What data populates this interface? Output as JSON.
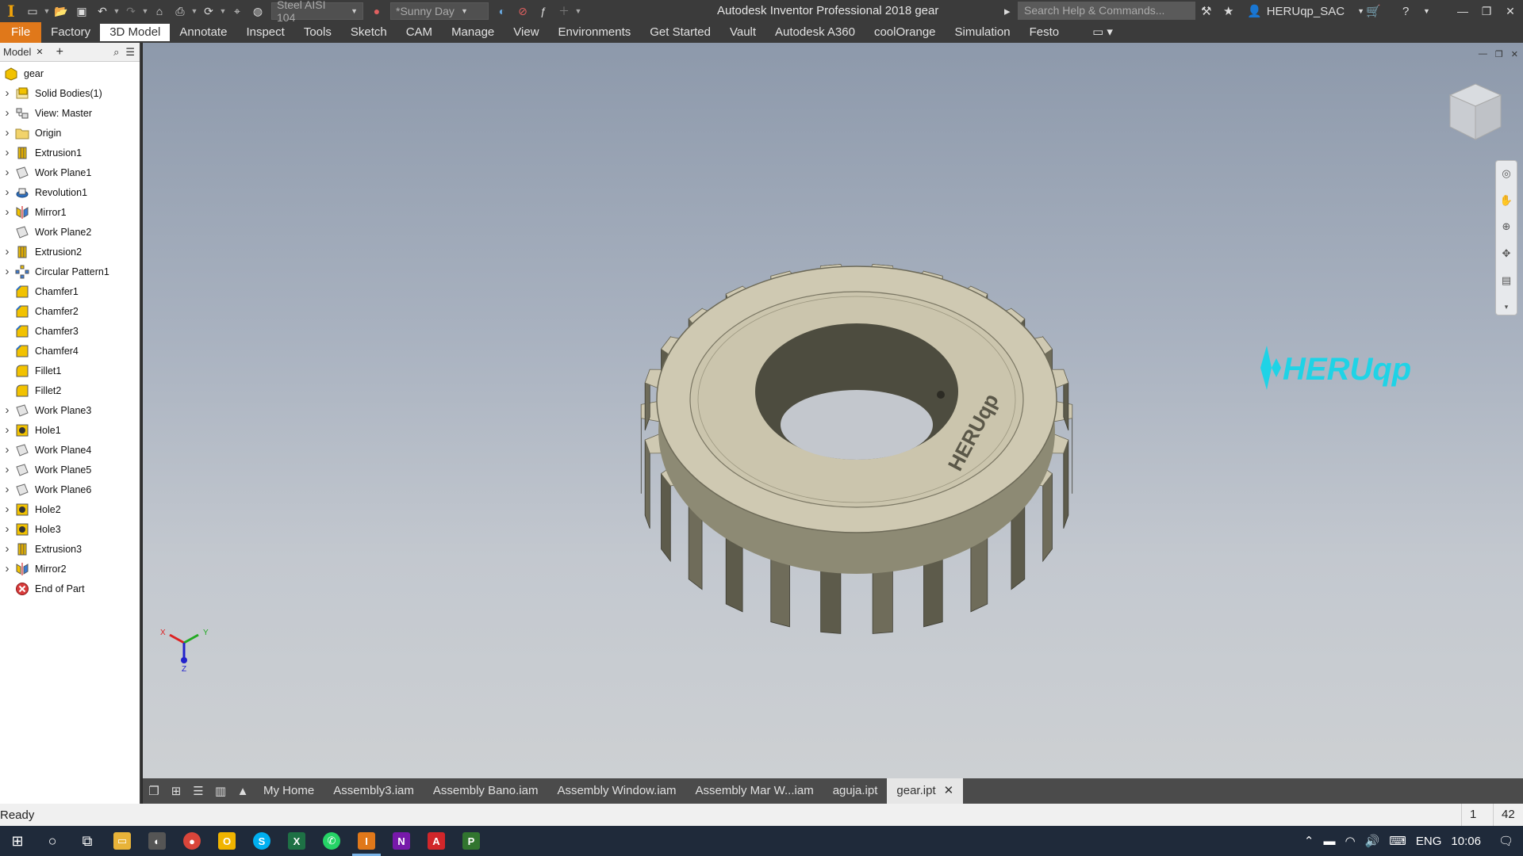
{
  "titlebar": {
    "material": "Steel AISI 104",
    "appearance": "*Sunny Day",
    "app_title": "Autodesk Inventor Professional 2018   gear",
    "search_placeholder": "Search Help & Commands...",
    "user": "HERUqp_SAC"
  },
  "ribbon": {
    "tabs": [
      "File",
      "Factory",
      "3D Model",
      "Annotate",
      "Inspect",
      "Tools",
      "Sketch",
      "CAM",
      "Manage",
      "View",
      "Environments",
      "Get Started",
      "Vault",
      "Autodesk A360",
      "coolOrange",
      "Simulation",
      "Festo"
    ],
    "active_tab": "3D Model"
  },
  "browser": {
    "tab": "Model",
    "tree": [
      {
        "label": "gear",
        "icon": "part-icon",
        "expander": false,
        "root": true
      },
      {
        "label": "Solid Bodies(1)",
        "icon": "solid-bodies-icon",
        "expander": true
      },
      {
        "label": "View: Master",
        "icon": "view-icon",
        "expander": true
      },
      {
        "label": "Origin",
        "icon": "folder-icon",
        "expander": true
      },
      {
        "label": "Extrusion1",
        "icon": "extrusion-icon",
        "expander": true
      },
      {
        "label": "Work Plane1",
        "icon": "work-plane-icon",
        "expander": true
      },
      {
        "label": "Revolution1",
        "icon": "revolution-icon",
        "expander": true
      },
      {
        "label": "Mirror1",
        "icon": "mirror-icon",
        "expander": true
      },
      {
        "label": "Work Plane2",
        "icon": "work-plane-icon",
        "expander": false
      },
      {
        "label": "Extrusion2",
        "icon": "extrusion-icon",
        "expander": true
      },
      {
        "label": "Circular Pattern1",
        "icon": "circular-pattern-icon",
        "expander": true
      },
      {
        "label": "Chamfer1",
        "icon": "chamfer-icon",
        "expander": false
      },
      {
        "label": "Chamfer2",
        "icon": "chamfer-icon",
        "expander": false
      },
      {
        "label": "Chamfer3",
        "icon": "chamfer-icon",
        "expander": false
      },
      {
        "label": "Chamfer4",
        "icon": "chamfer-icon",
        "expander": false
      },
      {
        "label": "Fillet1",
        "icon": "fillet-icon",
        "expander": false
      },
      {
        "label": "Fillet2",
        "icon": "fillet-icon",
        "expander": false
      },
      {
        "label": "Work Plane3",
        "icon": "work-plane-icon",
        "expander": true
      },
      {
        "label": "Hole1",
        "icon": "hole-icon",
        "expander": true
      },
      {
        "label": "Work Plane4",
        "icon": "work-plane-icon",
        "expander": true
      },
      {
        "label": "Work Plane5",
        "icon": "work-plane-icon",
        "expander": true
      },
      {
        "label": "Work Plane6",
        "icon": "work-plane-icon",
        "expander": true
      },
      {
        "label": "Hole2",
        "icon": "hole-icon",
        "expander": true
      },
      {
        "label": "Hole3",
        "icon": "hole-icon",
        "expander": true
      },
      {
        "label": "Extrusion3",
        "icon": "extrusion-icon",
        "expander": true
      },
      {
        "label": "Mirror2",
        "icon": "mirror-icon",
        "expander": true
      },
      {
        "label": "End of Part",
        "icon": "end-of-part-icon",
        "expander": false
      }
    ]
  },
  "viewport": {
    "model_engraving": "HERUqp",
    "logo_text": "HERUqp",
    "triad": {
      "x": "X",
      "y": "Y",
      "z": "Z"
    }
  },
  "doc_tabs": {
    "tabs": [
      "My Home",
      "Assembly3.iam",
      "Assembly Bano.iam",
      "Assembly Window.iam",
      "Assembly Mar W...iam",
      "aguja.ipt"
    ],
    "active": "gear.ipt"
  },
  "statusbar": {
    "status": "Ready",
    "num1": "1",
    "num2": "42"
  },
  "taskbar": {
    "language": "ENG",
    "time": "10:06"
  },
  "colors": {
    "file_tab": "#e0781a",
    "gear_body": "#8d8a74",
    "logo": "#1fd3e6"
  }
}
